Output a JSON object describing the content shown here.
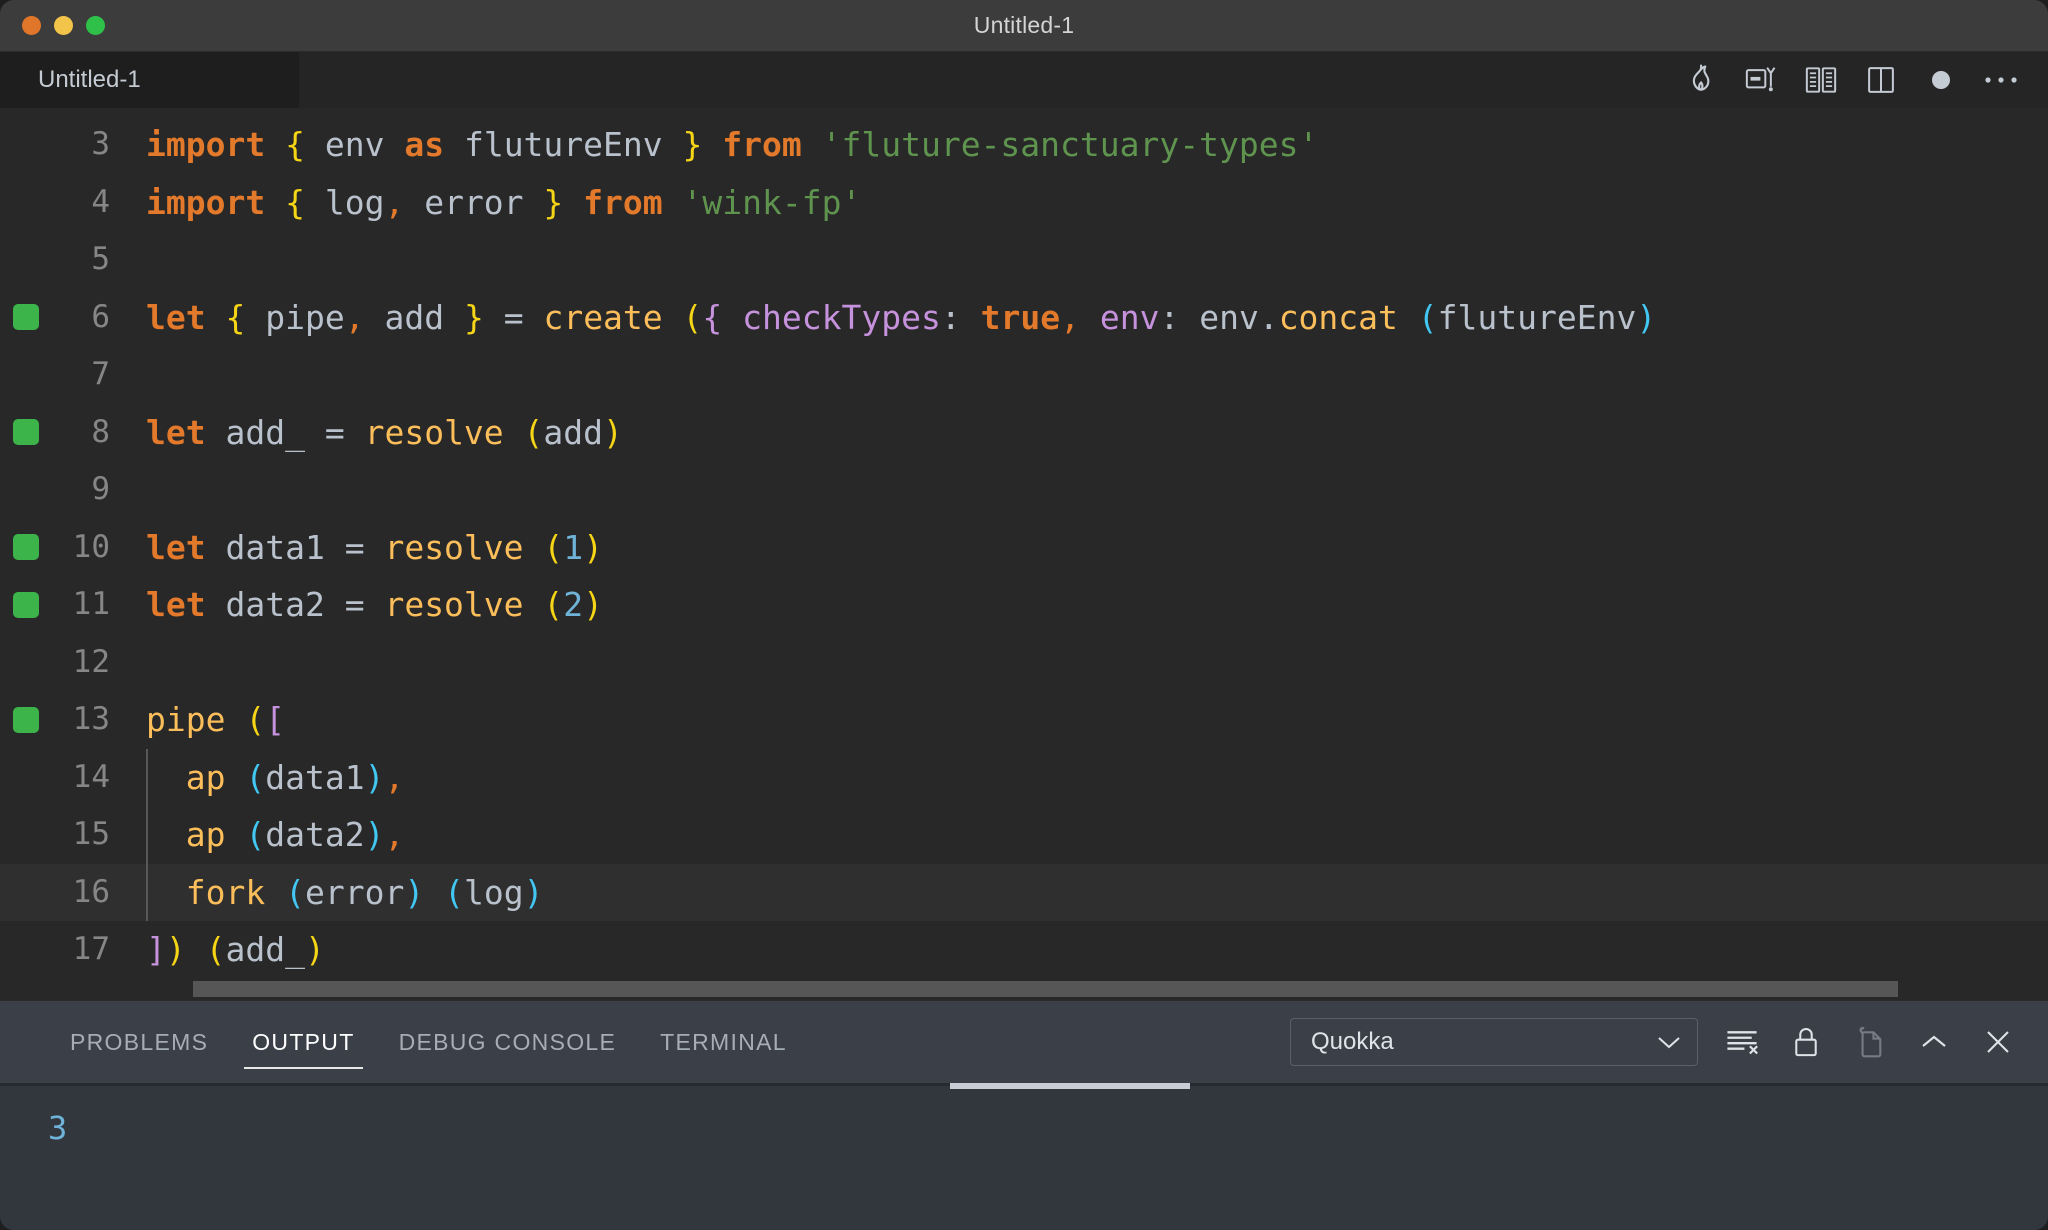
{
  "window": {
    "title": "Untitled-1",
    "traffic_lights": [
      "close-button",
      "minimize-button",
      "maximize-button"
    ]
  },
  "editor_tabbar": {
    "tab_label": "Untitled-1",
    "actions": [
      {
        "name": "quokka-flame-icon",
        "title": "Quokka"
      },
      {
        "name": "run-debug-icon",
        "title": "Run and Debug"
      },
      {
        "name": "open-preview-icon",
        "title": "Open Preview"
      },
      {
        "name": "split-editor-icon",
        "title": "Split Editor"
      },
      {
        "name": "unsaved-dot-icon",
        "title": "Unsaved changes"
      },
      {
        "name": "more-actions-icon",
        "title": "More Actions..."
      }
    ]
  },
  "editor": {
    "first_visible_line": 3,
    "active_line": 16,
    "lines": [
      {
        "no": "3",
        "mark": false,
        "indent": false
      },
      {
        "no": "4",
        "mark": false,
        "indent": false
      },
      {
        "no": "5",
        "mark": false,
        "indent": false
      },
      {
        "no": "6",
        "mark": true,
        "indent": false
      },
      {
        "no": "7",
        "mark": false,
        "indent": false
      },
      {
        "no": "8",
        "mark": true,
        "indent": false
      },
      {
        "no": "9",
        "mark": false,
        "indent": false
      },
      {
        "no": "10",
        "mark": true,
        "indent": false
      },
      {
        "no": "11",
        "mark": true,
        "indent": false
      },
      {
        "no": "12",
        "mark": false,
        "indent": false
      },
      {
        "no": "13",
        "mark": true,
        "indent": false
      },
      {
        "no": "14",
        "mark": false,
        "indent": true
      },
      {
        "no": "15",
        "mark": false,
        "indent": true
      },
      {
        "no": "16",
        "mark": false,
        "indent": true
      },
      {
        "no": "17",
        "mark": false,
        "indent": false
      }
    ],
    "code": {
      "l3": "import { env as flutureEnv } from 'fluture-sanctuary-types'",
      "l4": "import { log, error } from 'wink-fp'",
      "l5": "",
      "l6": "let { pipe, add } = create ({ checkTypes: true, env: env.concat (flutureEnv)",
      "l7": "",
      "l8": "let add_ = resolve (add)",
      "l9": "",
      "l10": "let data1 = resolve (1)",
      "l11": "let data2 = resolve (2)",
      "l12": "",
      "l13": "pipe ([",
      "l14": "  ap (data1),",
      "l15": "  ap (data2),",
      "l16": "  fork (error) (log)",
      "l17": "]) (add_)"
    }
  },
  "panel": {
    "tabs": [
      {
        "label": "PROBLEMS",
        "active": false
      },
      {
        "label": "OUTPUT",
        "active": true
      },
      {
        "label": "DEBUG CONSOLE",
        "active": false
      },
      {
        "label": "TERMINAL",
        "active": false
      }
    ],
    "channel_select": {
      "value": "Quokka",
      "chevron": "chevron-down-icon"
    },
    "actions": [
      {
        "name": "clear-output-icon",
        "title": "Clear Output"
      },
      {
        "name": "lock-scroll-icon",
        "title": "Turn Auto Scrolling Off"
      },
      {
        "name": "open-in-editor-icon",
        "title": "Open Output in Editor"
      },
      {
        "name": "maximize-panel-icon",
        "title": "Maximize Panel Size"
      },
      {
        "name": "close-panel-icon",
        "title": "Close Panel"
      }
    ],
    "output_text": "3"
  },
  "colors": {
    "editor_bg": "#282828",
    "panel_bg": "#3b4048",
    "output_bg": "#32373e",
    "titlebar_bg": "#3c3c3c",
    "tabbar_bg": "#252526",
    "keyword": "#e3792b",
    "function": "#fbbe5a",
    "string": "#5f944f",
    "number": "#6fb3d9",
    "property": "#c792dd",
    "identifier": "#b9c2cc",
    "bracket_yellow": "#f5d515",
    "bracket_purple": "#c792dd",
    "bracket_cyan": "#41c7f2",
    "quokka_marker": "#3cb44a"
  }
}
